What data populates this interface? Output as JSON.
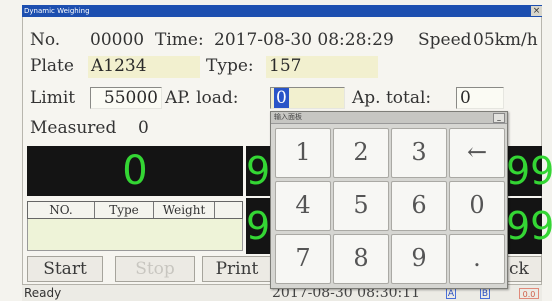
{
  "window": {
    "title": "Dynamic Weighing",
    "close": "×"
  },
  "info": {
    "no_label": "No.",
    "no_value": "00000",
    "time_label": "Time:",
    "time_value": "2017-08-30 08:28:29",
    "speed_label": "Speed",
    "speed_value": "05km/h"
  },
  "plate": {
    "label": "Plate",
    "value": "A1234"
  },
  "type": {
    "label": "Type:",
    "value": "157"
  },
  "limit": {
    "label": "Limit",
    "value": "55000"
  },
  "ap_load": {
    "label": "AP. load:",
    "value": "0"
  },
  "ap_total": {
    "label": "Ap. total:",
    "value": "0"
  },
  "measured": {
    "label": "Measured",
    "value": "0"
  },
  "displays": {
    "main": "0",
    "left_top": "9",
    "left_bottom": "9",
    "right_top": "99",
    "right_bottom": "99"
  },
  "table": {
    "headers": [
      "NO.",
      "Type",
      "Weight"
    ]
  },
  "buttons": {
    "start": "Start",
    "stop": "Stop",
    "print": "Print",
    "back_partial": "ck"
  },
  "keypad": {
    "title": "输入面板",
    "minimize": "_",
    "keys": [
      "1",
      "2",
      "3",
      "←",
      "4",
      "5",
      "6",
      "0",
      "7",
      "8",
      "9",
      "."
    ]
  },
  "status": {
    "ready": "Ready",
    "datetime": "2017-08-30 08:30:11",
    "ind_a": "A",
    "ind_b": "B",
    "ind_c": "0.0"
  },
  "colors": {
    "title_bar": "#1d4fb0",
    "digit": "#34d634",
    "display_bg": "#141414"
  }
}
